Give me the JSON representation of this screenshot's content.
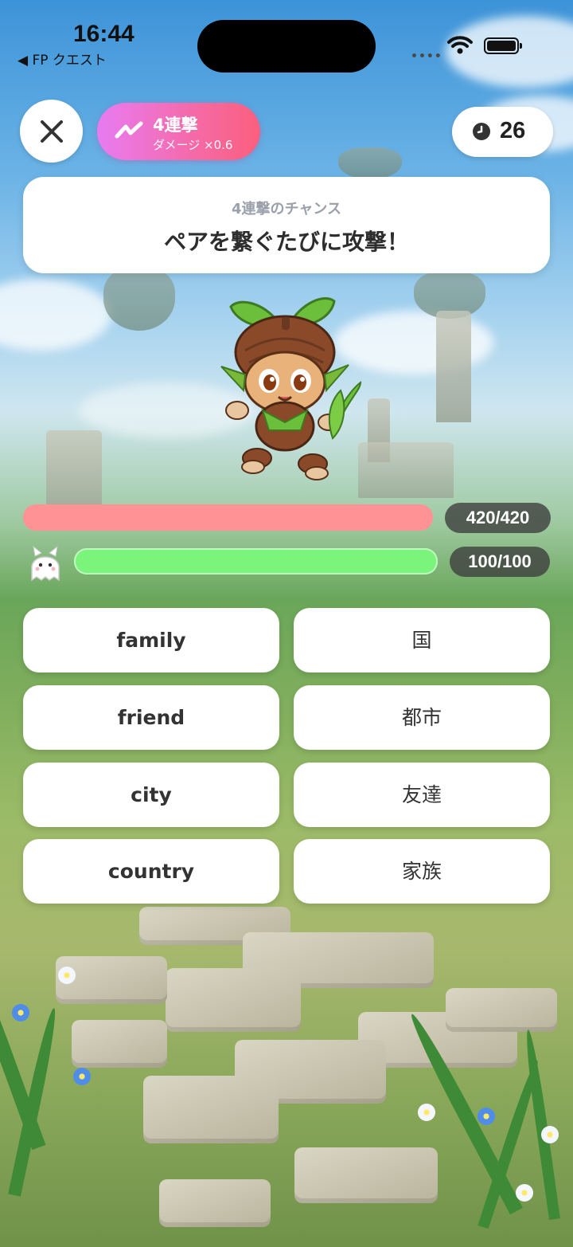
{
  "status_bar": {
    "time": "16:44",
    "back_label": "◀ FP クエスト",
    "signal_icon": "signal-dots-icon",
    "wifi_icon": "wifi-icon",
    "battery_icon": "battery-icon"
  },
  "header": {
    "close_icon": "close-icon",
    "combo": {
      "icon": "combo-zigzag-icon",
      "title": "4連撃",
      "damage_text": "ダメージ ×0.6"
    },
    "timer": {
      "icon": "clock-icon",
      "value": "26"
    }
  },
  "prompt": {
    "subtitle": "4連撃のチャンス",
    "title": "ペアを繋ぐたびに攻撃！"
  },
  "enemy": {
    "name_icon": "acorn-monster",
    "hp_text": "420/420",
    "hp_fraction": 1.0
  },
  "player": {
    "avatar_icon": "ghost-cat-avatar",
    "hp_text": "100/100",
    "hp_fraction": 1.0
  },
  "answers": {
    "left": [
      "family",
      "friend",
      "city",
      "country"
    ],
    "right": [
      "国",
      "都市",
      "友達",
      "家族"
    ]
  },
  "colors": {
    "combo_start": "#e87bf2",
    "combo_end": "#fb5f7d",
    "enemy_hp": "#ff9294",
    "player_hp": "#7af47a"
  }
}
